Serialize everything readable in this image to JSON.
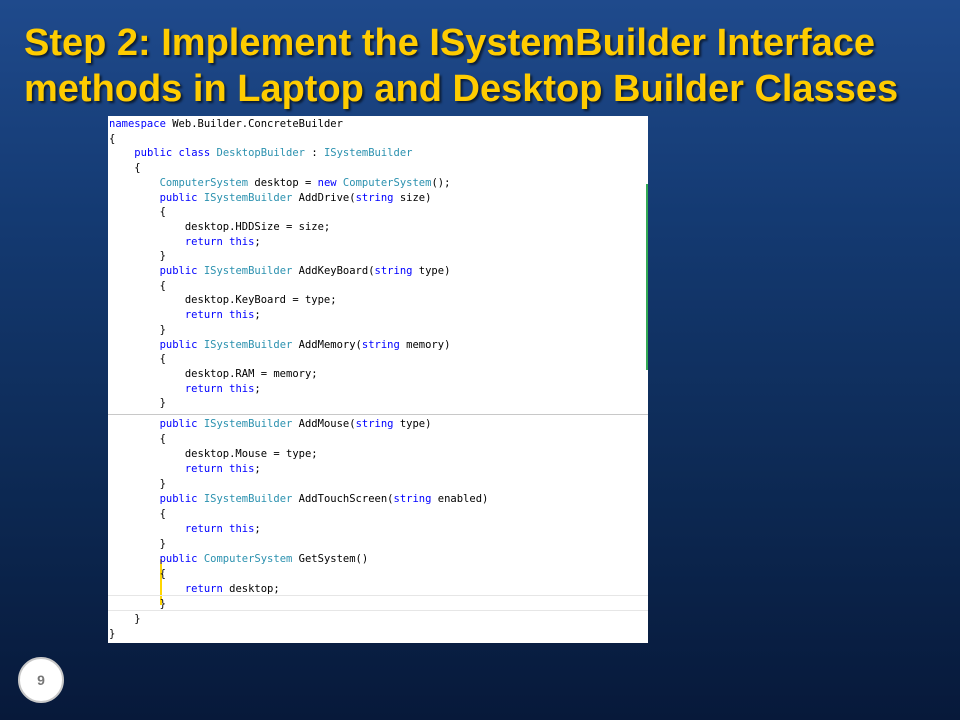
{
  "title": {
    "line1": "Step 2: Implement the ISystemBuilder Interface",
    "line2": "methods in Laptop and Desktop Builder Classes"
  },
  "page_number": "9",
  "code_top": {
    "l1": {
      "kw": "namespace",
      "rest": " Web.Builder.ConcreteBuilder"
    },
    "l2": {
      "text": "{"
    },
    "l3": {
      "indent": "    ",
      "kw1": "public",
      "kw2": " class",
      "name": " DesktopBuilder",
      "sep": " : ",
      "iface": "ISystemBuilder"
    },
    "l4": {
      "text": "    {"
    },
    "l5": {
      "indent": "        ",
      "type1": "ComputerSystem",
      "mid": " desktop = ",
      "kw": "new",
      "type2": " ComputerSystem",
      "end": "();"
    },
    "l6": {
      "indent": "        ",
      "kw": "public",
      "type": " ISystemBuilder",
      "name": " AddDrive(",
      "ptype": "string",
      "end": " size)"
    },
    "l7": {
      "text": "        {"
    },
    "l8": {
      "text": "            desktop.HDDSize = size;"
    },
    "l9": {
      "indent": "            ",
      "kw": "return",
      "kw2": " this",
      "end": ";"
    },
    "l10": {
      "text": "        }"
    },
    "l11": {
      "indent": "        ",
      "kw": "public",
      "type": " ISystemBuilder",
      "name": " AddKeyBoard(",
      "ptype": "string",
      "end": " type)"
    },
    "l12": {
      "text": "        {"
    },
    "l13": {
      "text": "            desktop.KeyBoard = type;"
    },
    "l14": {
      "indent": "            ",
      "kw": "return",
      "kw2": " this",
      "end": ";"
    },
    "l15": {
      "text": "        }"
    },
    "l16": {
      "indent": "        ",
      "kw": "public",
      "type": " ISystemBuilder",
      "name": " AddMemory(",
      "ptype": "string",
      "end": " memory)"
    },
    "l17": {
      "text": "        {"
    },
    "l18": {
      "text": "            desktop.RAM = memory;"
    },
    "l19": {
      "indent": "            ",
      "kw": "return",
      "kw2": " this",
      "end": ";"
    },
    "l20": {
      "text": "        }"
    }
  },
  "code_bottom": {
    "l1": {
      "indent": "        ",
      "kw": "public",
      "type": " ISystemBuilder",
      "name": " AddMouse(",
      "ptype": "string",
      "end": " type)"
    },
    "l2": {
      "text": "        {"
    },
    "l3": {
      "text": "            desktop.Mouse = type;"
    },
    "l4": {
      "indent": "            ",
      "kw": "return",
      "kw2": " this",
      "end": ";"
    },
    "l5": {
      "text": "        }"
    },
    "l6": {
      "indent": "        ",
      "kw": "public",
      "type": " ISystemBuilder",
      "name": " AddTouchScreen(",
      "ptype": "string",
      "end": " enabled)"
    },
    "l7": {
      "text": "        {"
    },
    "l8": {
      "indent": "            ",
      "kw": "return",
      "kw2": " this",
      "end": ";"
    },
    "l9": {
      "text": "        }"
    },
    "l10": {
      "indent": "        ",
      "kw": "public",
      "type": " ComputerSystem",
      "name": " GetSystem()"
    },
    "l11": {
      "text": "        {"
    },
    "l12": {
      "indent": "            ",
      "kw": "return",
      "end": " desktop;"
    },
    "l13": {
      "text": "        }"
    },
    "l14": {
      "text": "    }"
    },
    "l15": {
      "text": "}"
    }
  }
}
